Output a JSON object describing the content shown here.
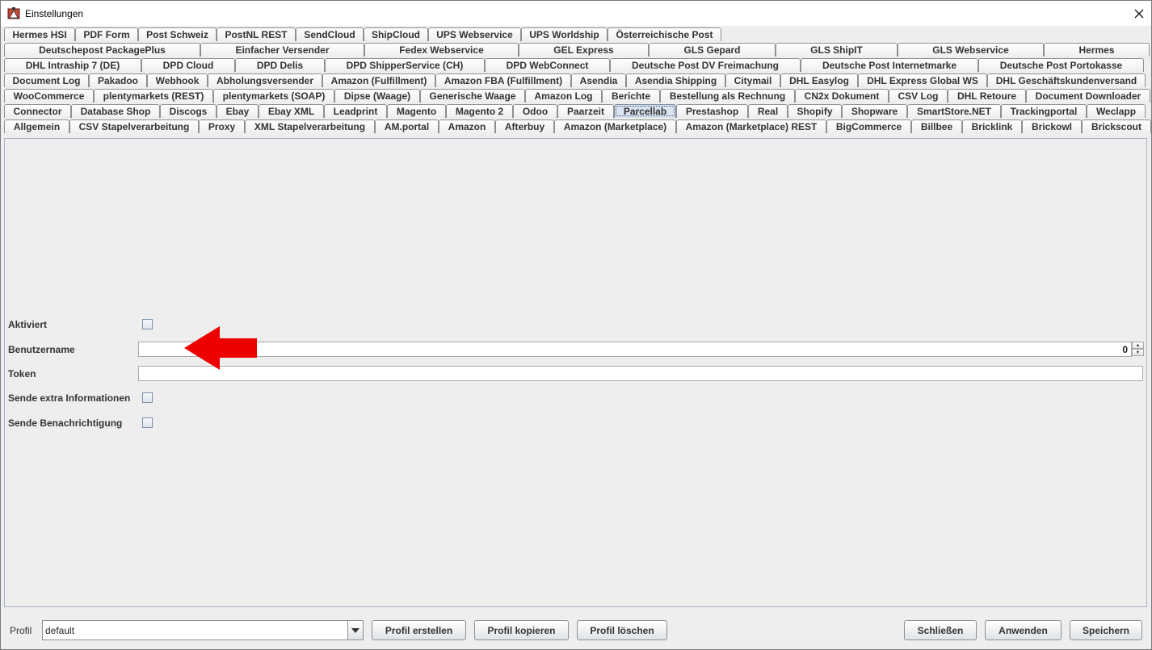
{
  "window": {
    "title": "Einstellungen",
    "close_glyph": "✕"
  },
  "tabs": {
    "rows": [
      [
        "Hermes HSI",
        "PDF Form",
        "Post Schweiz",
        "PostNL REST",
        "SendCloud",
        "ShipCloud",
        "UPS Webservice",
        "UPS Worldship",
        "Österreichische Post"
      ],
      [
        "Deutschepost PackagePlus",
        "Einfacher Versender",
        "Fedex Webservice",
        "GEL Express",
        "GLS Gepard",
        "GLS ShipIT",
        "GLS Webservice",
        "Hermes"
      ],
      [
        "DHL Intraship 7 (DE)",
        "DPD Cloud",
        "DPD Delis",
        "DPD ShipperService (CH)",
        "DPD WebConnect",
        "Deutsche Post DV Freimachung",
        "Deutsche Post Internetmarke",
        "Deutsche Post Portokasse"
      ],
      [
        "Document Log",
        "Pakadoo",
        "Webhook",
        "Abholungsversender",
        "Amazon (Fulfillment)",
        "Amazon FBA (Fulfillment)",
        "Asendia",
        "Asendia Shipping",
        "Citymail",
        "DHL Easylog",
        "DHL Express Global WS",
        "DHL Geschäftskundenversand"
      ],
      [
        "WooCommerce",
        "plentymarkets (REST)",
        "plentymarkets (SOAP)",
        "Dipse (Waage)",
        "Generische Waage",
        "Amazon Log",
        "Berichte",
        "Bestellung als Rechnung",
        "CN2x Dokument",
        "CSV Log",
        "DHL Retoure",
        "Document Downloader"
      ],
      [
        "Connector",
        "Database Shop",
        "Discogs",
        "Ebay",
        "Ebay XML",
        "Leadprint",
        "Magento",
        "Magento 2",
        "Odoo",
        "Paarzeit",
        "Parcellab",
        "Prestashop",
        "Real",
        "Shopify",
        "Shopware",
        "SmartStore.NET",
        "Trackingportal",
        "Weclapp"
      ],
      [
        "Allgemein",
        "CSV Stapelverarbeitung",
        "Proxy",
        "XML Stapelverarbeitung",
        "AM.portal",
        "Amazon",
        "Afterbuy",
        "Amazon (Marketplace)",
        "Amazon (Marketplace) REST",
        "BigCommerce",
        "Billbee",
        "Bricklink",
        "Brickowl",
        "Brickscout"
      ]
    ],
    "selected": "Parcellab"
  },
  "form": {
    "aktiviert": {
      "label": "Aktiviert",
      "checked": false
    },
    "benutzername": {
      "label": "Benutzername",
      "value": "",
      "number": "0"
    },
    "token": {
      "label": "Token",
      "value": ""
    },
    "extra_info": {
      "label": "Sende extra Informationen",
      "checked": false
    },
    "benachrichtigung": {
      "label": "Sende Benachrichtigung",
      "checked": false
    }
  },
  "annotation": {
    "arrow_color": "#ee0000"
  },
  "bottom": {
    "profil_label": "Profil",
    "profil_value": "default",
    "buttons": {
      "create": "Profil erstellen",
      "copy": "Profil kopieren",
      "delete": "Profil löschen",
      "close": "Schließen",
      "apply": "Anwenden",
      "save": "Speichern"
    }
  }
}
